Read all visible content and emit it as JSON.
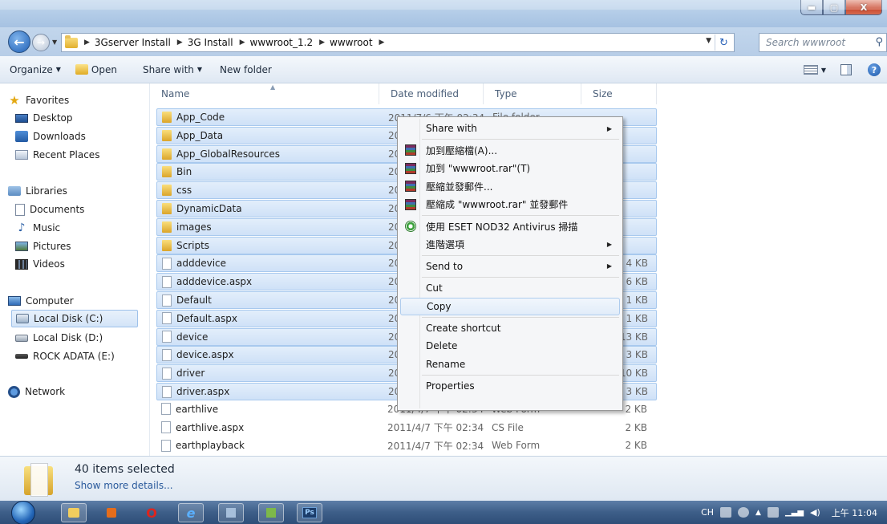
{
  "window": {
    "controls": {
      "minimize": "▬",
      "maximize": "▢",
      "close": "X"
    }
  },
  "nav": {
    "breadcrumb": [
      "3Gserver Install",
      "3G Install",
      "wwwroot_1.2",
      "wwwroot"
    ],
    "search_placeholder": "Search wwwroot"
  },
  "toolbar": {
    "organize": "Organize",
    "open": "Open",
    "share_with": "Share with",
    "new_folder": "New folder"
  },
  "sidebar": {
    "favorites": {
      "label": "Favorites",
      "items": [
        "Desktop",
        "Downloads",
        "Recent Places"
      ]
    },
    "libraries": {
      "label": "Libraries",
      "items": [
        "Documents",
        "Music",
        "Pictures",
        "Videos"
      ]
    },
    "computer": {
      "label": "Computer",
      "items": [
        "Local Disk (C:)",
        "Local Disk (D:)",
        "ROCK ADATA (E:)"
      ]
    },
    "network": {
      "label": "Network"
    }
  },
  "columns": {
    "name": "Name",
    "date": "Date modified",
    "type": "Type",
    "size": "Size"
  },
  "files": [
    {
      "name": "App_Code",
      "kind": "folder",
      "date": "2011/7/6 下午 02:34",
      "type": "File folder",
      "size": ""
    },
    {
      "name": "App_Data",
      "kind": "folder",
      "date": "20",
      "type": "",
      "size": ""
    },
    {
      "name": "App_GlobalResources",
      "kind": "folder",
      "date": "20",
      "type": "",
      "size": ""
    },
    {
      "name": "Bin",
      "kind": "folder",
      "date": "20",
      "type": "",
      "size": ""
    },
    {
      "name": "css",
      "kind": "folder",
      "date": "20",
      "type": "",
      "size": ""
    },
    {
      "name": "DynamicData",
      "kind": "folder",
      "date": "20",
      "type": "",
      "size": ""
    },
    {
      "name": "images",
      "kind": "folder",
      "date": "20",
      "type": "",
      "size": ""
    },
    {
      "name": "Scripts",
      "kind": "folder",
      "date": "20",
      "type": "",
      "size": ""
    },
    {
      "name": "adddevice",
      "kind": "file",
      "date": "20",
      "type": "",
      "size": "4 KB"
    },
    {
      "name": "adddevice.aspx",
      "kind": "file",
      "date": "20",
      "type": "",
      "size": "6 KB"
    },
    {
      "name": "Default",
      "kind": "file",
      "date": "20",
      "type": "",
      "size": "1 KB"
    },
    {
      "name": "Default.aspx",
      "kind": "file",
      "date": "20",
      "type": "",
      "size": "1 KB"
    },
    {
      "name": "device",
      "kind": "file",
      "date": "20",
      "type": "",
      "size": "13 KB"
    },
    {
      "name": "device.aspx",
      "kind": "file",
      "date": "20",
      "type": "",
      "size": "3 KB"
    },
    {
      "name": "driver",
      "kind": "file",
      "date": "20",
      "type": "",
      "size": "10 KB"
    },
    {
      "name": "driver.aspx",
      "kind": "file",
      "date": "20",
      "type": "",
      "size": "3 KB"
    },
    {
      "name": "earthlive",
      "kind": "file",
      "date": "2011/4/7 下午 02:34",
      "type": "Web Form",
      "size": "2 KB"
    },
    {
      "name": "earthlive.aspx",
      "kind": "file",
      "date": "2011/4/7 下午 02:34",
      "type": "CS File",
      "size": "2 KB"
    },
    {
      "name": "earthplayback",
      "kind": "file",
      "date": "2011/4/7 下午 02:34",
      "type": "Web Form",
      "size": "2 KB"
    }
  ],
  "context_menu": [
    {
      "label": "Share with",
      "submenu": true
    },
    {
      "sep": true
    },
    {
      "label": "加到壓縮檔(A)...",
      "icon": "rar"
    },
    {
      "label": "加到 \"wwwroot.rar\"(T)",
      "icon": "rar"
    },
    {
      "label": "壓縮並發郵件...",
      "icon": "rar"
    },
    {
      "label": "壓縮成 \"wwwroot.rar\" 並發郵件",
      "icon": "rar"
    },
    {
      "sep": true
    },
    {
      "label": "使用 ESET NOD32 Antivirus 掃描",
      "icon": "eset"
    },
    {
      "label": "進階選項",
      "submenu": true
    },
    {
      "sep": true
    },
    {
      "label": "Send to",
      "submenu": true
    },
    {
      "sep": true
    },
    {
      "label": "Cut"
    },
    {
      "label": "Copy",
      "hover": true
    },
    {
      "sep": true
    },
    {
      "label": "Create shortcut"
    },
    {
      "label": "Delete"
    },
    {
      "label": "Rename"
    },
    {
      "sep": true
    },
    {
      "label": "Properties"
    }
  ],
  "details": {
    "count": "40 items selected",
    "more": "Show more details..."
  },
  "taskbar": {
    "lang": "CH",
    "clock": "上午 11:04",
    "ps_label": "Ps"
  }
}
